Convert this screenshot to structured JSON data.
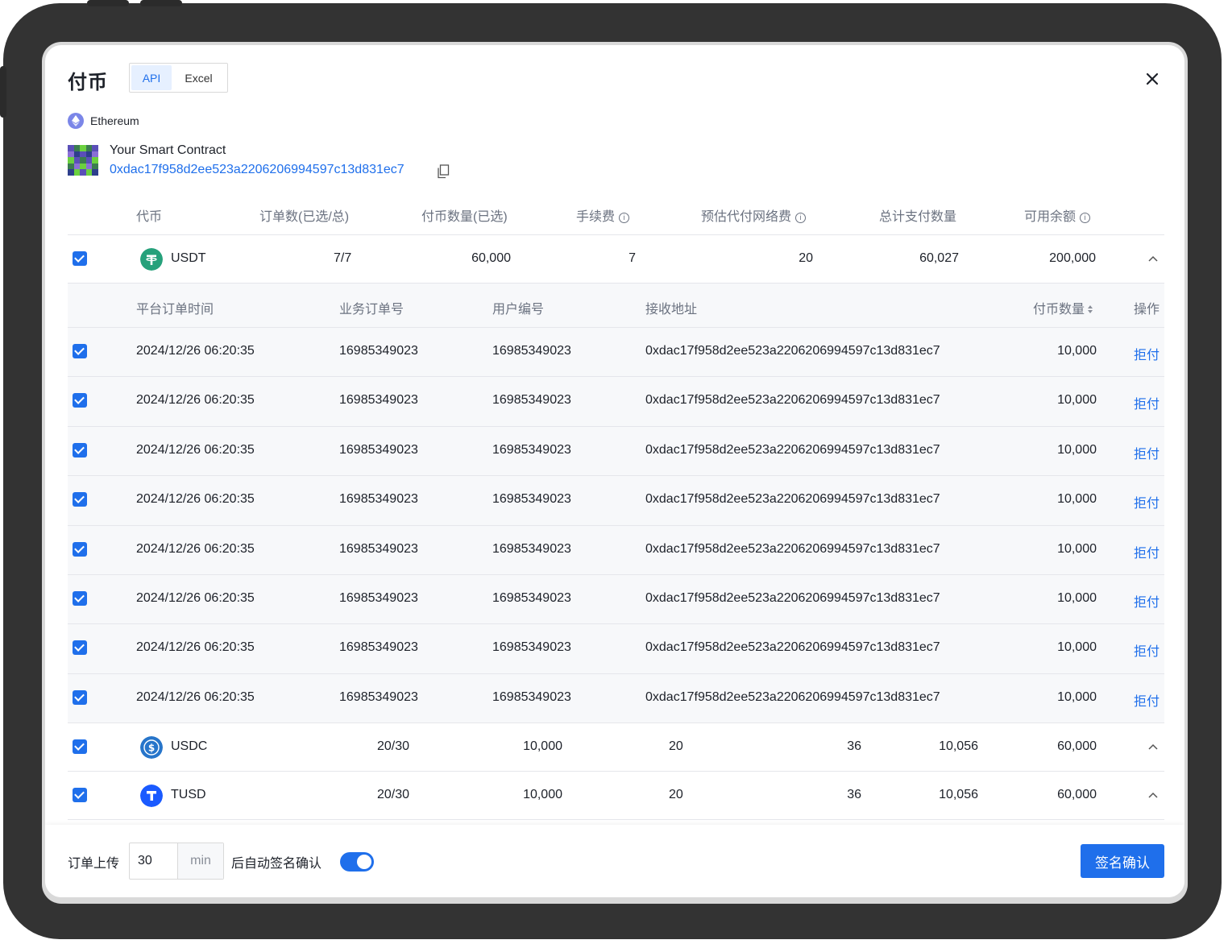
{
  "dialog": {
    "title": "付币",
    "tabs": [
      "API",
      "Excel"
    ],
    "active_tab": "API"
  },
  "chain": {
    "name": "Ethereum",
    "icon": "ethereum-icon"
  },
  "contract": {
    "name": "Your Smart Contract",
    "address": "0xdac17f958d2ee523a2206206994597c13d831ec7"
  },
  "table": {
    "headers": [
      "代币",
      "订单数(已选/总)",
      "付币数量(已选)",
      "手续费",
      "预估代付网络费",
      "总计支付数量",
      "可用余额"
    ],
    "sub_headers": [
      "平台订单时间",
      "业务订单号",
      "用户编号",
      "接收地址",
      "付币数量",
      "操作"
    ],
    "tokens": [
      {
        "symbol": "USDT",
        "orders": "7/7",
        "amount": "60,000",
        "fee": "7",
        "network_fee": "20",
        "total": "60,027",
        "balance": "200,000",
        "color": "#26a17b"
      },
      {
        "symbol": "USDC",
        "orders": "20/30",
        "amount": "10,000",
        "fee": "20",
        "network_fee": "36",
        "total": "10,056",
        "balance": "60,000",
        "color": "#2775ca"
      },
      {
        "symbol": "TUSD",
        "orders": "20/30",
        "amount": "10,000",
        "fee": "20",
        "network_fee": "36",
        "total": "10,056",
        "balance": "60,000",
        "color": "#1a5aff"
      }
    ],
    "orders": [
      {
        "time": "2024/12/26 06:20:35",
        "biz_no": "16985349023",
        "user_no": "16985349023",
        "address": "0xdac17f958d2ee523a2206206994597c13d831ec7",
        "amount": "10,000",
        "action": "拒付"
      },
      {
        "time": "2024/12/26 06:20:35",
        "biz_no": "16985349023",
        "user_no": "16985349023",
        "address": "0xdac17f958d2ee523a2206206994597c13d831ec7",
        "amount": "10,000",
        "action": "拒付"
      },
      {
        "time": "2024/12/26 06:20:35",
        "biz_no": "16985349023",
        "user_no": "16985349023",
        "address": "0xdac17f958d2ee523a2206206994597c13d831ec7",
        "amount": "10,000",
        "action": "拒付"
      },
      {
        "time": "2024/12/26 06:20:35",
        "biz_no": "16985349023",
        "user_no": "16985349023",
        "address": "0xdac17f958d2ee523a2206206994597c13d831ec7",
        "amount": "10,000",
        "action": "拒付"
      },
      {
        "time": "2024/12/26 06:20:35",
        "biz_no": "16985349023",
        "user_no": "16985349023",
        "address": "0xdac17f958d2ee523a2206206994597c13d831ec7",
        "amount": "10,000",
        "action": "拒付"
      },
      {
        "time": "2024/12/26 06:20:35",
        "biz_no": "16985349023",
        "user_no": "16985349023",
        "address": "0xdac17f958d2ee523a2206206994597c13d831ec7",
        "amount": "10,000",
        "action": "拒付"
      },
      {
        "time": "2024/12/26 06:20:35",
        "biz_no": "16985349023",
        "user_no": "16985349023",
        "address": "0xdac17f958d2ee523a2206206994597c13d831ec7",
        "amount": "10,000",
        "action": "拒付"
      },
      {
        "time": "2024/12/26 06:20:35",
        "biz_no": "16985349023",
        "user_no": "16985349023",
        "address": "0xdac17f958d2ee523a2206206994597c13d831ec7",
        "amount": "10,000",
        "action": "拒付"
      }
    ]
  },
  "footer": {
    "label_before": "订单上传",
    "minutes": "30",
    "unit": "min",
    "label_after": "后自动签名确认",
    "auto_sign_enabled": true,
    "confirm_label": "签名确认"
  },
  "colors": {
    "accent": "#1f6feb",
    "frame": "#333333"
  }
}
